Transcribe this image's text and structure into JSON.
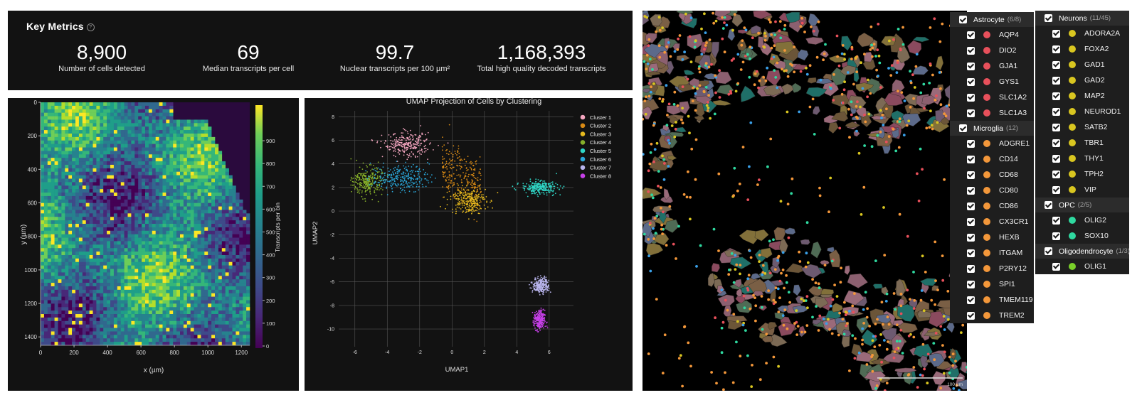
{
  "metrics": {
    "title": "Key Metrics",
    "help_icon": "?",
    "items": [
      {
        "value": "8,900",
        "label": "Number of cells detected"
      },
      {
        "value": "69",
        "label": "Median transcripts per cell"
      },
      {
        "value": "99.7",
        "label": "Nuclear transcripts per 100 µm²"
      },
      {
        "value": "1,168,393",
        "label": "Total high quality decoded transcripts"
      }
    ]
  },
  "heatmap": {
    "xlabel": "x (µm)",
    "ylabel": "y (µm)",
    "colorbar_label": "Transcripts per bin",
    "x_ticks": [
      "0",
      "200",
      "400",
      "600",
      "800",
      "1000",
      "1200"
    ],
    "y_ticks": [
      "0",
      "200",
      "400",
      "600",
      "800",
      "1000",
      "1200",
      "1400"
    ],
    "colorbar_ticks": [
      "0",
      "100",
      "200",
      "300",
      "400",
      "500",
      "600",
      "700",
      "800",
      "900"
    ]
  },
  "chart_data": {
    "type": "scatter",
    "title": "UMAP Projection of Cells by Clustering",
    "xlabel": "UMAP1",
    "ylabel": "UMAP2",
    "xlim": [
      -7,
      7.5
    ],
    "ylim": [
      -11.5,
      8.5
    ],
    "x_ticks": [
      -6,
      -4,
      -2,
      0,
      2,
      4,
      6
    ],
    "y_ticks": [
      8,
      6,
      4,
      2,
      0,
      -2,
      -4,
      -6,
      -8,
      -10
    ],
    "grid": true,
    "legend_position": "top-right",
    "series": [
      {
        "name": "Cluster 1",
        "color": "#f4a6c0",
        "cx": -2.8,
        "cy": 5.6,
        "sx": 1.3,
        "sy": 0.9
      },
      {
        "name": "Cluster 2",
        "color": "#d98a14",
        "cx": 0.2,
        "cy": 3.2,
        "sx": 1.4,
        "sy": 1.8
      },
      {
        "name": "Cluster 3",
        "color": "#e6b91e",
        "cx": 1.0,
        "cy": 0.9,
        "sx": 1.0,
        "sy": 1.0
      },
      {
        "name": "Cluster 4",
        "color": "#86b02a",
        "cx": -5.2,
        "cy": 2.5,
        "sx": 0.8,
        "sy": 1.1
      },
      {
        "name": "Cluster 5",
        "color": "#2fd6c6",
        "cx": 5.4,
        "cy": 2.0,
        "sx": 1.0,
        "sy": 0.5
      },
      {
        "name": "Cluster 6",
        "color": "#2aa6d8",
        "cx": -3.2,
        "cy": 2.8,
        "sx": 1.6,
        "sy": 1.0
      },
      {
        "name": "Cluster 7",
        "color": "#b8b4ec",
        "cx": 5.5,
        "cy": -6.3,
        "sx": 0.45,
        "sy": 0.6
      },
      {
        "name": "Cluster 8",
        "color": "#c640e8",
        "cx": 5.4,
        "cy": -9.3,
        "sx": 0.3,
        "sy": 0.8
      }
    ]
  },
  "spatial": {
    "scale_label": "100 µm",
    "legend_left": [
      {
        "name": "Astrocyte",
        "count": "(6/8)",
        "color": "#e8505b",
        "genes": [
          "AQP4",
          "DIO2",
          "GJA1",
          "GYS1",
          "SLC1A2",
          "SLC1A3"
        ]
      },
      {
        "name": "Microglia",
        "count": "(12)",
        "color": "#f3973a",
        "genes": [
          "ADGRE1",
          "CD14",
          "CD68",
          "CD80",
          "CD86",
          "CX3CR1",
          "HEXB",
          "ITGAM",
          "P2RY12",
          "SPI1",
          "TMEM119",
          "TREM2"
        ]
      }
    ],
    "legend_right": [
      {
        "name": "Neurons",
        "count": "(11/45)",
        "color": "#d9c620",
        "genes": [
          "ADORA2A",
          "FOXA2",
          "GAD1",
          "GAD2",
          "MAP2",
          "NEUROD1",
          "SATB2",
          "TBR1",
          "THY1",
          "TPH2",
          "VIP"
        ]
      },
      {
        "name": "OPC",
        "count": "(2/5)",
        "color": "#2fd9a0",
        "genes": [
          "OLIG2",
          "SOX10"
        ]
      },
      {
        "name": "Oligodendrocyte",
        "count": "(1/3)",
        "color": "#7ad02a",
        "genes": [
          "OLIG1"
        ]
      }
    ]
  }
}
